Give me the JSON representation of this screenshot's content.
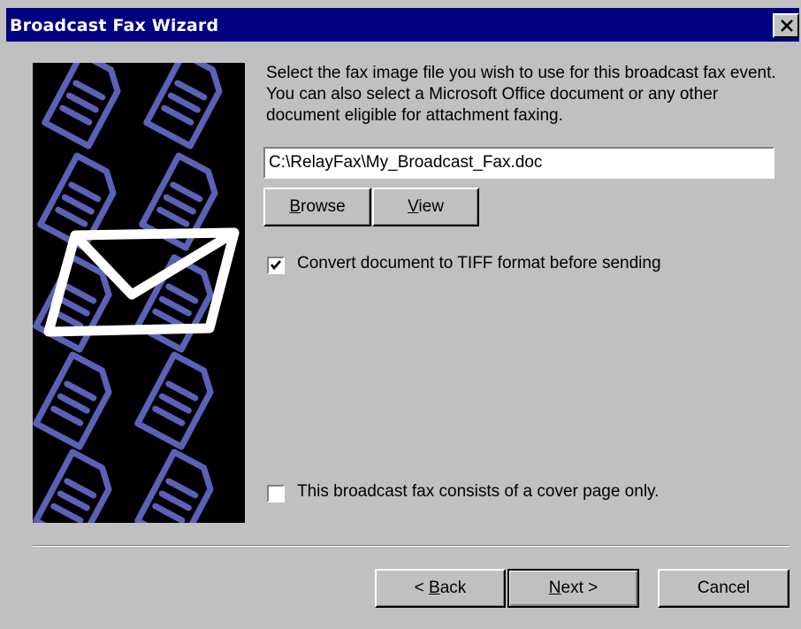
{
  "window": {
    "title": "Broadcast Fax Wizard",
    "colors": {
      "titlebar": "#000080",
      "face": "#c0c0c0",
      "art_accent": "#5a62b8"
    }
  },
  "main": {
    "instructions": "Select the fax image file you wish to use for this broadcast fax event.  You can also select a Microsoft Office document or any other document eligible for attachment faxing.",
    "file_path": "C:\\RelayFax\\My_Broadcast_Fax.doc",
    "browse": {
      "mnemonic": "B",
      "rest": "rowse"
    },
    "view": {
      "mnemonic": "V",
      "rest": "iew"
    },
    "convert_tiff": {
      "label": "Convert document to TIFF format before sending",
      "checked": true
    },
    "cover_only": {
      "label": "This broadcast fax consists of a cover page only.",
      "checked": false
    }
  },
  "footer": {
    "back": {
      "pre": "< ",
      "mnemonic": "B",
      "rest": "ack"
    },
    "next": {
      "mnemonic": "N",
      "rest": "ext >"
    },
    "cancel": "Cancel"
  },
  "icons": [
    "close-icon",
    "checkmark-icon",
    "envelope-icon",
    "document-icon"
  ]
}
